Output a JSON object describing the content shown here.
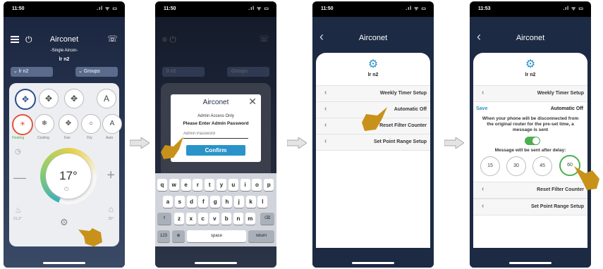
{
  "brand": "Airconet",
  "screens": [
    {
      "time": "11:50"
    },
    {
      "time": "11:50"
    },
    {
      "time": "11:50"
    },
    {
      "time": "11:53"
    }
  ],
  "s1": {
    "subtitle": "-Single Aircon-",
    "device": "lr n2",
    "dropdown_left": "lr n2",
    "dropdown_right": "Groups",
    "modes": [
      "Heating",
      "Cooling",
      "Fan",
      "Dry",
      "Auto"
    ],
    "temperature": "17°",
    "left_value": "21.2°",
    "right_value": "25°"
  },
  "s2": {
    "dialog_line1": "Admin Access Only",
    "dialog_line2": "Please Enter Admin Password",
    "password_placeholder": "Admin Password",
    "confirm": "Confirm",
    "row1": [
      "q",
      "w",
      "e",
      "r",
      "t",
      "y",
      "u",
      "i",
      "o",
      "p"
    ],
    "row2": [
      "a",
      "s",
      "d",
      "f",
      "g",
      "h",
      "j",
      "k",
      "l"
    ],
    "row3": [
      "z",
      "x",
      "c",
      "v",
      "b",
      "n",
      "m"
    ],
    "num_key": "123",
    "space": "space",
    "return": "return",
    "device": "lr n2",
    "groups": "Groups"
  },
  "s3": {
    "device": "lr n2",
    "items": [
      "Weekly Timer Setup",
      "Automatic Off",
      "Reset Filter Counter",
      "Set Point Range Setup"
    ]
  },
  "s4": {
    "device": "lr n2",
    "weekly": "Weekly Timer Setup",
    "save": "Save",
    "automatic_off": "Automatic Off",
    "description": "When your phone will be disconnected from the original router for the pre-set time, a message is sent",
    "delay_label": "Message will be sent after delay:",
    "delays": [
      "15",
      "30",
      "45",
      "60"
    ],
    "reset": "Reset Filter Counter",
    "setpoint": "Set Point Range Setup"
  },
  "colors": {
    "accent": "#2a93c9",
    "green": "#4caf50",
    "nav_bg": "#1d2a44",
    "hand": "#c8921a"
  }
}
